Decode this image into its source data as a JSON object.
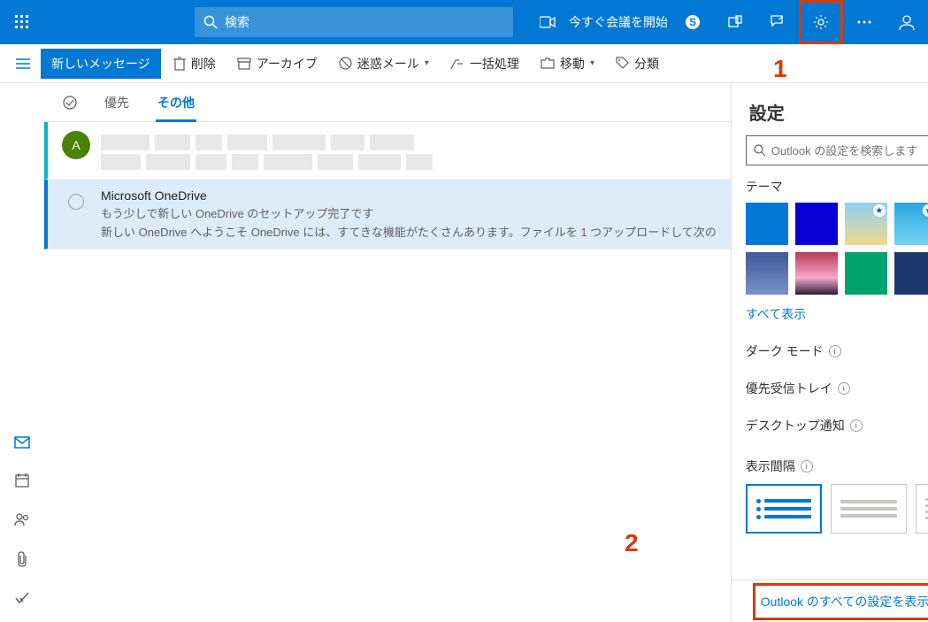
{
  "topbar": {
    "search_placeholder": "検索",
    "meet_now": "今すぐ会議を開始"
  },
  "actionbar": {
    "new_message": "新しいメッセージ",
    "delete": "削除",
    "archive": "アーカイブ",
    "junk": "迷惑メール",
    "sweep": "一括処理",
    "move": "移動",
    "categorize": "分類"
  },
  "tabs": {
    "focused": "優先",
    "other": "その他"
  },
  "messages": [
    {
      "avatar_letter": "A",
      "sender": "",
      "subject": "",
      "preview": ""
    },
    {
      "sender": "Microsoft OneDrive",
      "subject": "もう少しで新しい OneDrive のセットアップ完了です",
      "preview": "新しい OneDrive へようこそ OneDrive には、すてきな機能がたくさんあります。ファイルを 1 つアップロードして次の"
    }
  ],
  "settings": {
    "title": "設定",
    "search_placeholder": "Outlook の設定を検索します",
    "theme_label": "テーマ",
    "show_all": "すべて表示",
    "dark_mode": "ダーク モード",
    "focused_inbox": "優先受信トレイ",
    "desktop_notif": "デスクトップ通知",
    "density": "表示間隔",
    "all_settings": "Outlook のすべての設定を表示"
  },
  "annotations": {
    "n1": "1",
    "n2": "2"
  }
}
